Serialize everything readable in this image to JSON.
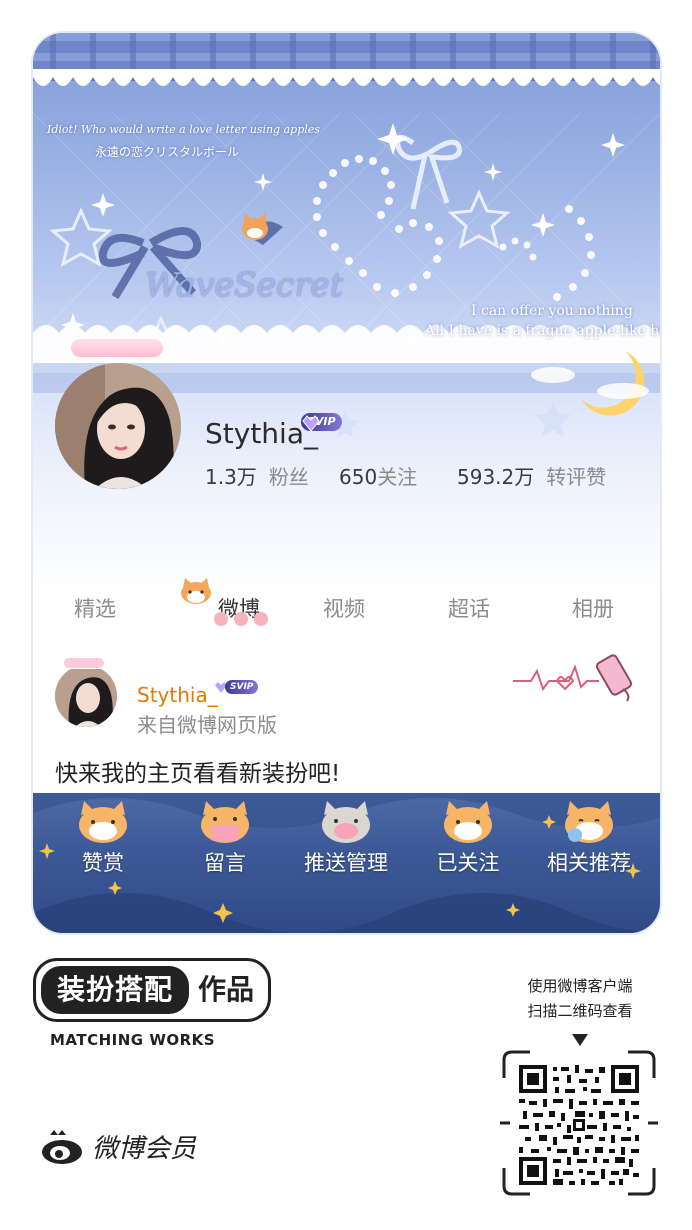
{
  "banner": {
    "line1": "Idiot! Who would write a love letter using apples",
    "line2": "永遠の恋クリスタルボール",
    "logo_text": "WaveSecret",
    "quote1": "I can offer you nothing",
    "quote2": "All I have is a frague apple-like heart"
  },
  "profile": {
    "username": "Stythia_",
    "badge": "SVIP",
    "stats": [
      {
        "value": "1.3万",
        "label": "粉丝"
      },
      {
        "value": "650",
        "label": "关注"
      },
      {
        "value": "593.2万",
        "label": "转评赞"
      }
    ]
  },
  "tabs": [
    {
      "label": "精选"
    },
    {
      "label": "微博"
    },
    {
      "label": "视频"
    },
    {
      "label": "超话"
    },
    {
      "label": "相册"
    }
  ],
  "post": {
    "author": "Stythia_",
    "badge": "SVIP",
    "source": "来自微博网页版",
    "text": "快来我的主页看看新装扮吧!"
  },
  "actions": [
    {
      "label": "赞赏"
    },
    {
      "label": "留言"
    },
    {
      "label": "推送管理"
    },
    {
      "label": "已关注"
    },
    {
      "label": "相关推荐"
    }
  ],
  "footer": {
    "brand_left": "装扮搭配",
    "brand_right": "作品",
    "brand_sub": "MATCHING WORKS",
    "logo_text": "微博会员",
    "qr_hint_line1": "使用微博客户端",
    "qr_hint_line2": "扫描二维码查看"
  },
  "colors": {
    "accent_orange": "#e07a00",
    "banner_blue": "#7f9ad6",
    "action_bar": "#3d5a98"
  },
  "icons": [
    "star-icon",
    "ribbon-icon",
    "moon-icon",
    "cat-icon",
    "heart-pulse-icon",
    "weibo-eye-icon",
    "qr-code-icon"
  ]
}
